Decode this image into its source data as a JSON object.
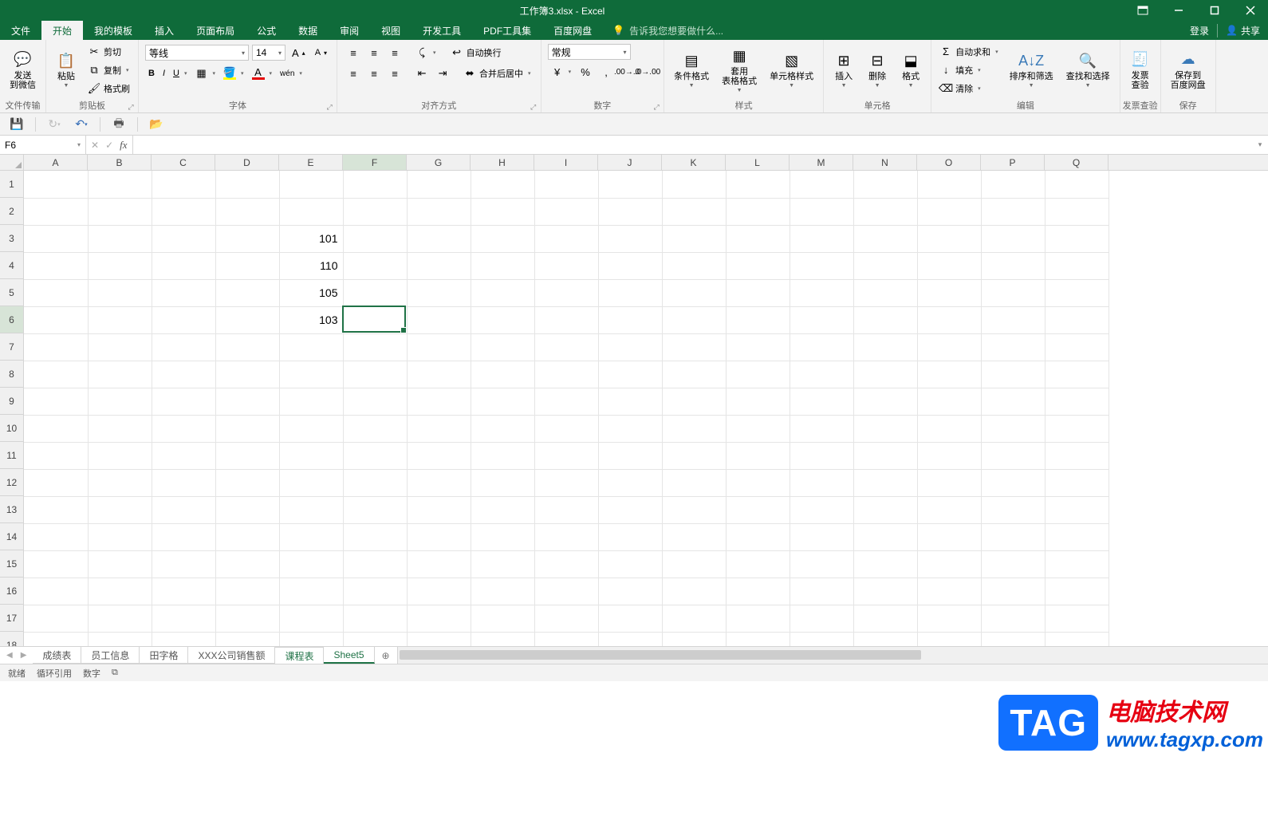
{
  "title": "工作簿3.xlsx - Excel",
  "tabs": {
    "file": "文件",
    "home": "开始",
    "templates": "我的模板",
    "insert": "插入",
    "pagelayout": "页面布局",
    "formulas": "公式",
    "data": "数据",
    "review": "审阅",
    "view": "视图",
    "developer": "开发工具",
    "pdfkit": "PDF工具集",
    "baidu": "百度网盘",
    "tellme_placeholder": "告诉我您想要做什么...",
    "login": "登录",
    "share": "共享"
  },
  "ribbon": {
    "send": {
      "line1": "发送",
      "line2": "到微信",
      "group": "文件传输"
    },
    "clipboard": {
      "paste": "粘贴",
      "cut": "剪切",
      "copy": "复制",
      "formatpainter": "格式刷",
      "group": "剪贴板"
    },
    "font": {
      "name": "等线",
      "size": "14",
      "pinyin": "wén",
      "group": "字体"
    },
    "alignment": {
      "wrap": "自动换行",
      "merge": "合并后居中",
      "group": "对齐方式"
    },
    "number": {
      "format": "常规",
      "group": "数字"
    },
    "styles": {
      "condfmt": "条件格式",
      "tablefmt": {
        "l1": "套用",
        "l2": "表格格式"
      },
      "cellstyle": "单元格样式",
      "group": "样式"
    },
    "cells": {
      "insert": "插入",
      "delete": "删除",
      "format": "格式",
      "group": "单元格"
    },
    "editing": {
      "autosum": "自动求和",
      "fill": "填充",
      "clear": "清除",
      "sort": "排序和筛选",
      "find": "查找和选择",
      "group": "编辑"
    },
    "invoice": {
      "l1": "发票",
      "l2": "查验",
      "group": "发票查验"
    },
    "save": {
      "l1": "保存到",
      "l2": "百度网盘",
      "group": "保存"
    }
  },
  "namebox": "F6",
  "columns": [
    "A",
    "B",
    "C",
    "D",
    "E",
    "F",
    "G",
    "H",
    "I",
    "J",
    "K",
    "L",
    "M",
    "N",
    "O",
    "P",
    "Q"
  ],
  "rows_shown": 18,
  "active": {
    "col": 5,
    "row": 5
  },
  "celldata": {
    "E3": "101",
    "E4": "110",
    "E5": "105",
    "E6": "103"
  },
  "sheets": {
    "items": [
      "成绩表",
      "员工信息",
      "田字格",
      "XXX公司销售额",
      "课程表",
      "Sheet5"
    ],
    "active": "课程表"
  },
  "status": {
    "ready": "就绪",
    "circ": "循环引用",
    "num": "数字",
    "scroll": ""
  },
  "watermark": {
    "tag": "TAG",
    "t1": "电脑技术网",
    "t2": "www.tagxp.com"
  }
}
